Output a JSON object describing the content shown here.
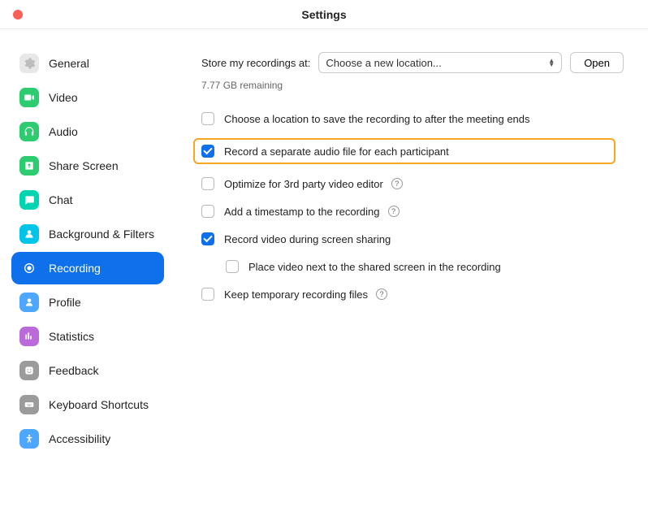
{
  "window": {
    "title": "Settings"
  },
  "sidebar": {
    "items": [
      {
        "id": "general",
        "label": "General",
        "icon": "gear",
        "color": "#e8e8e8",
        "glyph": "#bdbdbd"
      },
      {
        "id": "video",
        "label": "Video",
        "icon": "camera",
        "color": "#2ecc71",
        "glyph": "#ffffff"
      },
      {
        "id": "audio",
        "label": "Audio",
        "icon": "headphones",
        "color": "#2ecc71",
        "glyph": "#ffffff"
      },
      {
        "id": "share-screen",
        "label": "Share Screen",
        "icon": "share",
        "color": "#2ecc71",
        "glyph": "#ffffff"
      },
      {
        "id": "chat",
        "label": "Chat",
        "icon": "chat",
        "color": "#00d4b0",
        "glyph": "#ffffff"
      },
      {
        "id": "background",
        "label": "Background & Filters",
        "icon": "person",
        "color": "#00c4e8",
        "glyph": "#ffffff"
      },
      {
        "id": "recording",
        "label": "Recording",
        "icon": "record",
        "color": "#0e71eb",
        "glyph": "#ffffff",
        "active": true
      },
      {
        "id": "profile",
        "label": "Profile",
        "icon": "profile",
        "color": "#4da6ff",
        "glyph": "#ffffff"
      },
      {
        "id": "statistics",
        "label": "Statistics",
        "icon": "stats",
        "color": "#bb6bd9",
        "glyph": "#ffffff"
      },
      {
        "id": "feedback",
        "label": "Feedback",
        "icon": "feedback",
        "color": "#9b9b9b",
        "glyph": "#ffffff"
      },
      {
        "id": "keyboard",
        "label": "Keyboard Shortcuts",
        "icon": "keyboard",
        "color": "#9b9b9b",
        "glyph": "#ffffff"
      },
      {
        "id": "accessibility",
        "label": "Accessibility",
        "icon": "accessibility",
        "color": "#4da6ff",
        "glyph": "#ffffff"
      }
    ]
  },
  "main": {
    "store_label": "Store my recordings at:",
    "location_select": "Choose a new location...",
    "open_button": "Open",
    "remaining": "7.77 GB remaining",
    "options": [
      {
        "label": "Choose a location to save the recording to after the meeting ends",
        "checked": false
      },
      {
        "label": "Record a separate audio file for each participant",
        "checked": true,
        "highlight": true
      },
      {
        "label": "Optimize for 3rd party video editor",
        "checked": false,
        "help": true
      },
      {
        "label": "Add a timestamp to the recording",
        "checked": false,
        "help": true
      },
      {
        "label": "Record video during screen sharing",
        "checked": true
      },
      {
        "label": "Place video next to the shared screen in the recording",
        "checked": false,
        "indent": true
      },
      {
        "label": "Keep temporary recording files",
        "checked": false,
        "help": true
      }
    ]
  }
}
